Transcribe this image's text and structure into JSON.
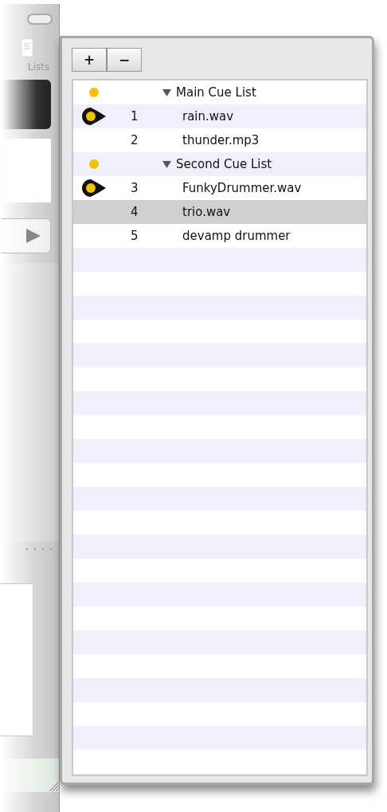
{
  "side_window": {
    "label": "Lists"
  },
  "toolbar": {
    "buttons": [
      "+",
      "−"
    ]
  },
  "rows": [
    {
      "kind": "list",
      "name": "Main Cue List",
      "expanded": true,
      "selected": false
    },
    {
      "kind": "cue",
      "number": "1",
      "name": "rain.wav",
      "playhead": true,
      "selected": false
    },
    {
      "kind": "cue",
      "number": "2",
      "name": "thunder.mp3",
      "playhead": false,
      "selected": false
    },
    {
      "kind": "list",
      "name": "Second Cue List",
      "expanded": true,
      "selected": false
    },
    {
      "kind": "cue",
      "number": "3",
      "name": "FunkyDrummer.wav",
      "playhead": true,
      "selected": false
    },
    {
      "kind": "cue",
      "number": "4",
      "name": "trio.wav",
      "playhead": false,
      "selected": true
    },
    {
      "kind": "cue",
      "number": "5",
      "name": "devamp drummer",
      "playhead": false,
      "selected": false
    }
  ]
}
